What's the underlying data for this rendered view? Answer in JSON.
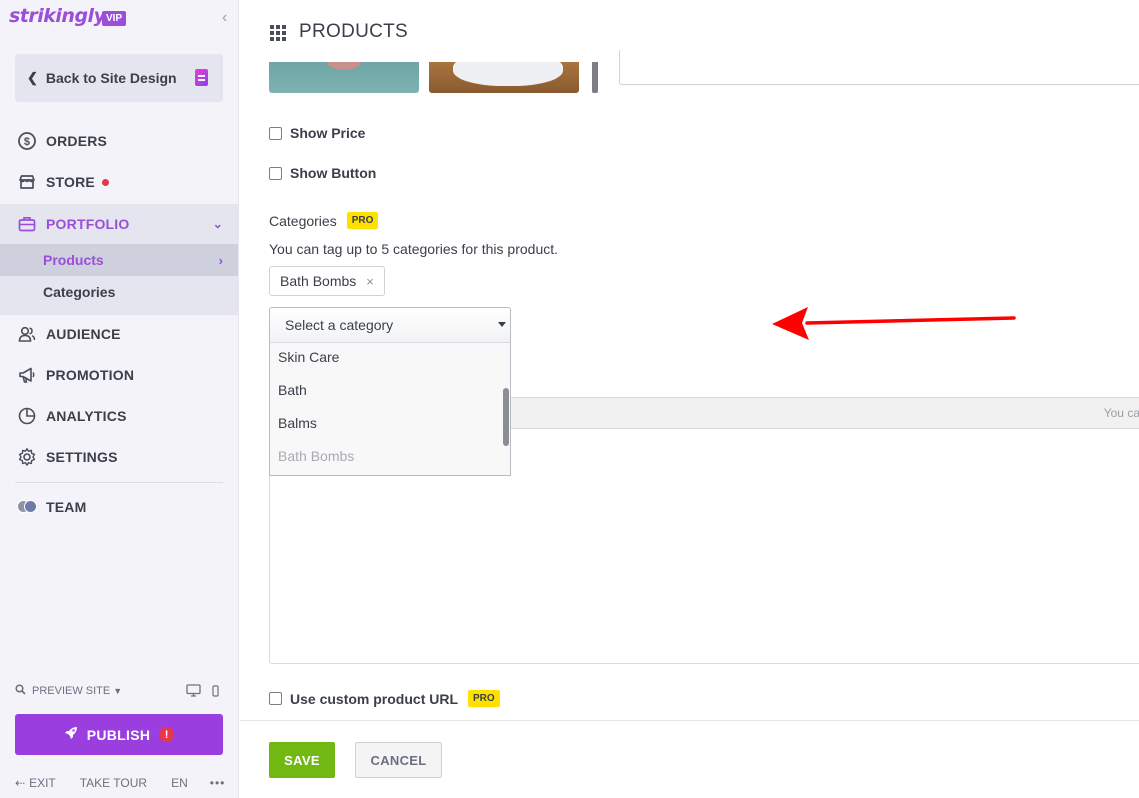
{
  "brand": {
    "logo_text": "strikingly",
    "badge": "VIP",
    "accent_color": "#9b4fd8"
  },
  "sidebar": {
    "back_label": "Back to Site Design",
    "nav": [
      {
        "label": "ORDERS",
        "icon": "dollar-circle-icon"
      },
      {
        "label": "STORE",
        "icon": "store-icon",
        "has_dot": true
      },
      {
        "label": "PORTFOLIO",
        "icon": "briefcase-icon",
        "active": true
      },
      {
        "label": "AUDIENCE",
        "icon": "people-icon"
      },
      {
        "label": "PROMOTION",
        "icon": "megaphone-icon"
      },
      {
        "label": "ANALYTICS",
        "icon": "pie-chart-icon"
      },
      {
        "label": "SETTINGS",
        "icon": "gear-icon"
      },
      {
        "label": "TEAM",
        "icon": "team-avatars-icon"
      }
    ],
    "portfolio_sub": [
      {
        "label": "Products",
        "active": true
      },
      {
        "label": "Categories"
      }
    ],
    "preview_label": "PREVIEW SITE",
    "publish_label": "PUBLISH",
    "publish_alert": "!",
    "footer": {
      "exit": "EXIT",
      "tour": "TAKE TOUR",
      "lang": "EN",
      "more": "•••"
    }
  },
  "main": {
    "title": "PRODUCTS",
    "show_price_label": "Show Price",
    "show_button_label": "Show Button",
    "categories_label": "Categories",
    "pro_badge": "PRO",
    "categories_help": "You can tag up to 5 categories for this product.",
    "selected_tags": [
      "Bath Bombs"
    ],
    "tag_remove": "×",
    "select_placeholder": "Select a category",
    "dropdown_options": [
      {
        "label": "Skin Care",
        "disabled": false
      },
      {
        "label": "Bath",
        "disabled": false
      },
      {
        "label": "Balms",
        "disabled": false
      },
      {
        "label": "Bath Bombs",
        "disabled": true
      }
    ],
    "editor_hint": "You car",
    "custom_url_label": "Use custom product URL",
    "save_label": "SAVE",
    "cancel_label": "CANCEL"
  },
  "colors": {
    "save_green": "#72b813",
    "publish_purple": "#9b3ee0",
    "pro_yellow": "#ffe100",
    "alert_red": "#e8364b",
    "arrow_red": "#ff0000"
  }
}
